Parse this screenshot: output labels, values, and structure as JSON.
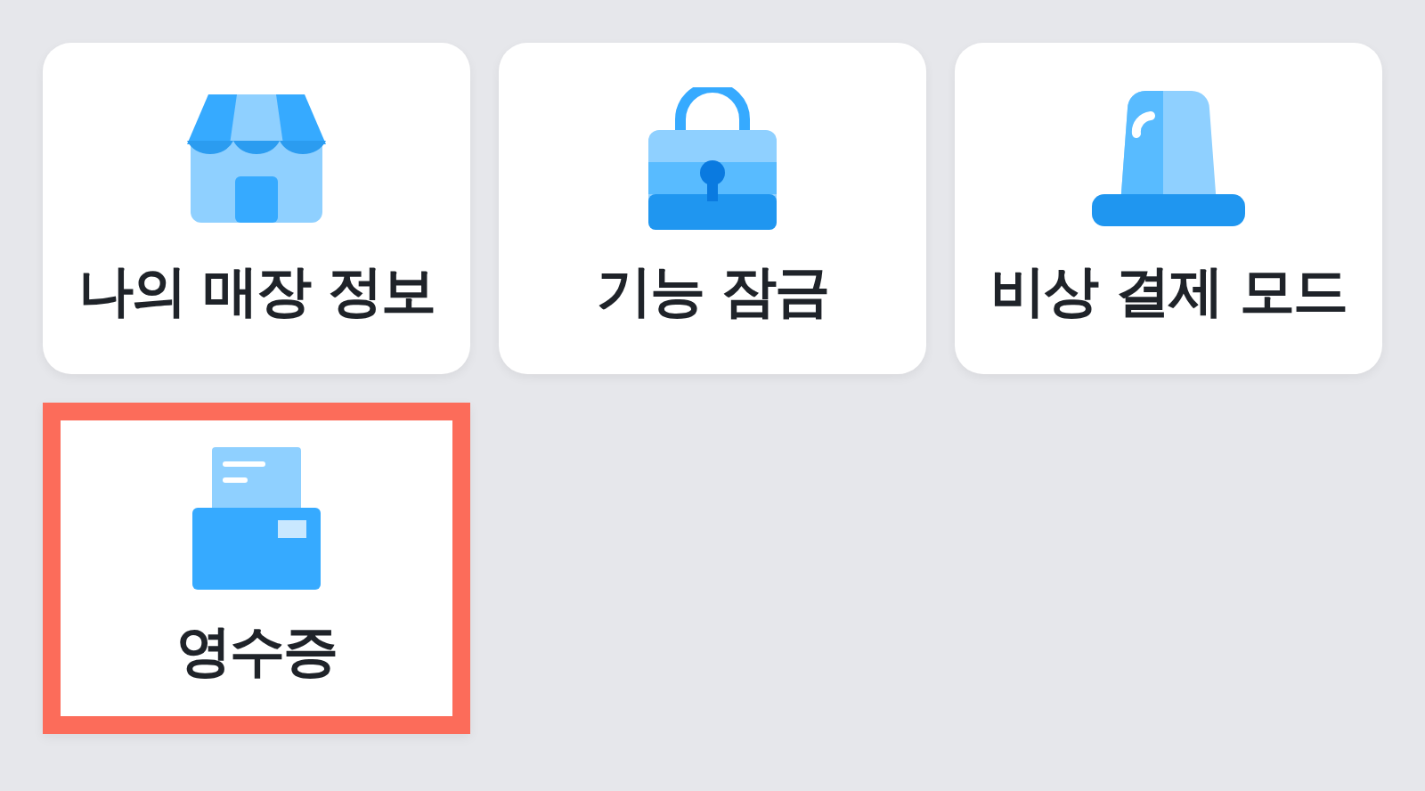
{
  "tiles": [
    {
      "label": "나의 매장 정보",
      "kind": "store",
      "selected": false
    },
    {
      "label": "기능 잠금",
      "kind": "lock",
      "selected": false
    },
    {
      "label": "비상 결제 모드",
      "kind": "siren",
      "selected": false
    },
    {
      "label": "영수증",
      "kind": "receipt",
      "selected": true
    }
  ]
}
